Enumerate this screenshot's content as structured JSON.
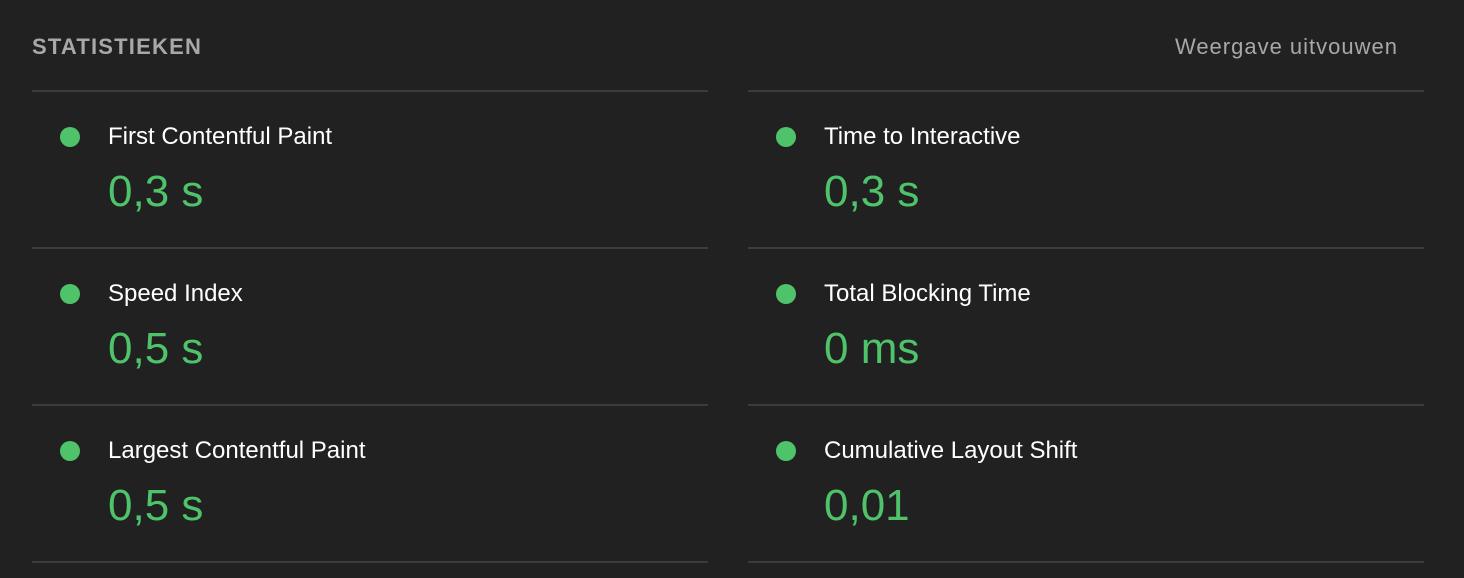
{
  "header": {
    "title": "STATISTIEKEN",
    "expand_label": "Weergave uitvouwen"
  },
  "colors": {
    "background": "#212121",
    "pass": "#4fc36a",
    "muted": "#a8a8a8",
    "divider": "#3c3c3c"
  },
  "metrics_left": [
    {
      "label": "First Contentful Paint",
      "value": "0,3 s",
      "status": "pass"
    },
    {
      "label": "Speed Index",
      "value": "0,5 s",
      "status": "pass"
    },
    {
      "label": "Largest Contentful Paint",
      "value": "0,5 s",
      "status": "pass"
    }
  ],
  "metrics_right": [
    {
      "label": "Time to Interactive",
      "value": "0,3 s",
      "status": "pass"
    },
    {
      "label": "Total Blocking Time",
      "value": "0 ms",
      "status": "pass"
    },
    {
      "label": "Cumulative Layout Shift",
      "value": "0,01",
      "status": "pass"
    }
  ]
}
